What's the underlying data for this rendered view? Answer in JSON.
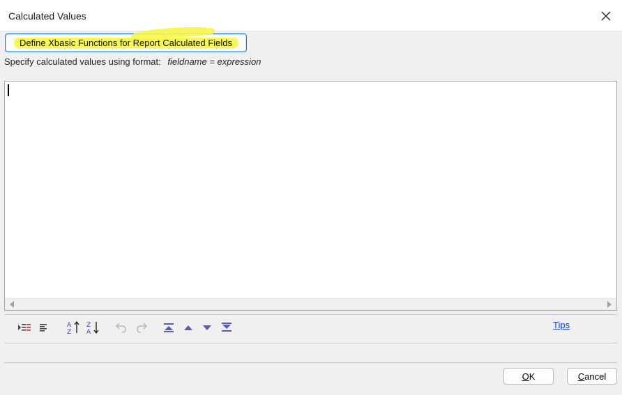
{
  "window": {
    "title": "Calculated Values",
    "close_icon": "close-icon"
  },
  "define_button": {
    "label": "Define Xbasic Functions for Report Calculated Fields"
  },
  "instruction": {
    "text": "Specify calculated values using format:",
    "format": "fieldname = expression"
  },
  "editor": {
    "value": ""
  },
  "toolbar": {
    "icons": [
      "indent-icon",
      "outdent-icon",
      "sort-ascending-icon",
      "sort-descending-icon",
      "undo-icon",
      "redo-icon",
      "move-top-icon",
      "move-up-icon",
      "move-down-icon",
      "move-bottom-icon"
    ]
  },
  "tips_label": "Tips",
  "footer": {
    "ok_prefix": "O",
    "ok_rest": "K",
    "cancel_prefix": "C",
    "cancel_rest": "ancel"
  },
  "colors": {
    "highlight": "#f6f64a",
    "accent": "#1e7bd6",
    "toolbar_icon": "#5a5ab8",
    "link": "#0b3fd6"
  }
}
